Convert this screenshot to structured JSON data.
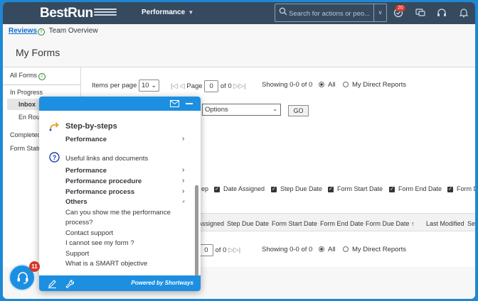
{
  "header": {
    "logo": "BestRun",
    "menu": "Performance",
    "search_placeholder": "Search for actions or peo...",
    "notification_count": "20"
  },
  "breadcrumb": {
    "reviews": "Reviews",
    "team_overview": "Team Overview"
  },
  "page_title": "My Forms",
  "sidebar": {
    "all_forms": "All Forms",
    "in_progress": "In Progress",
    "inbox": "Inbox",
    "en_route": "En Rou",
    "completed": "Completed",
    "form_status": "Form Statu"
  },
  "pager_top": {
    "items_label": "Items per page",
    "items_value": "10",
    "page_label": "Page",
    "page_value": "0",
    "of_label": "of 0",
    "showing": "Showing 0-0 of 0",
    "all": "All",
    "direct": "My Direct Reports"
  },
  "options": {
    "value": "Options",
    "go": "GO"
  },
  "checkbox_columns": [
    "ep",
    "Date Assigned",
    "Step Due Date",
    "Form Start Date",
    "Form End Date",
    "Form D"
  ],
  "table_headers": [
    "Assigned",
    "Step Due Date",
    "Form Start Date",
    "Form End Date",
    "Form Due Date",
    "Last Modified",
    "Se"
  ],
  "pager_bottom": {
    "prefix": "e",
    "page_value": "0",
    "of_label": "of 0",
    "showing": "Showing 0-0 of 0",
    "all": "All",
    "direct": "My Direct Reports"
  },
  "panel": {
    "section1_title": "Step-by-steps",
    "section1_item": "Performance",
    "section2_title": "Useful links and documents",
    "folders": [
      "Performance",
      "Performance procedure",
      "Performance process",
      "Others"
    ],
    "links": [
      "Can you show me the performance",
      "process?",
      "Contact support",
      "I cannot see my form ?",
      "Support",
      "What is a SMART objective"
    ],
    "powered": "Powered by Shortways"
  },
  "help_badge": "11",
  "colors": {
    "shell": "#354a5f",
    "accent": "#1d8fe0",
    "badge": "#d9362b",
    "link": "#0a6ed1"
  }
}
